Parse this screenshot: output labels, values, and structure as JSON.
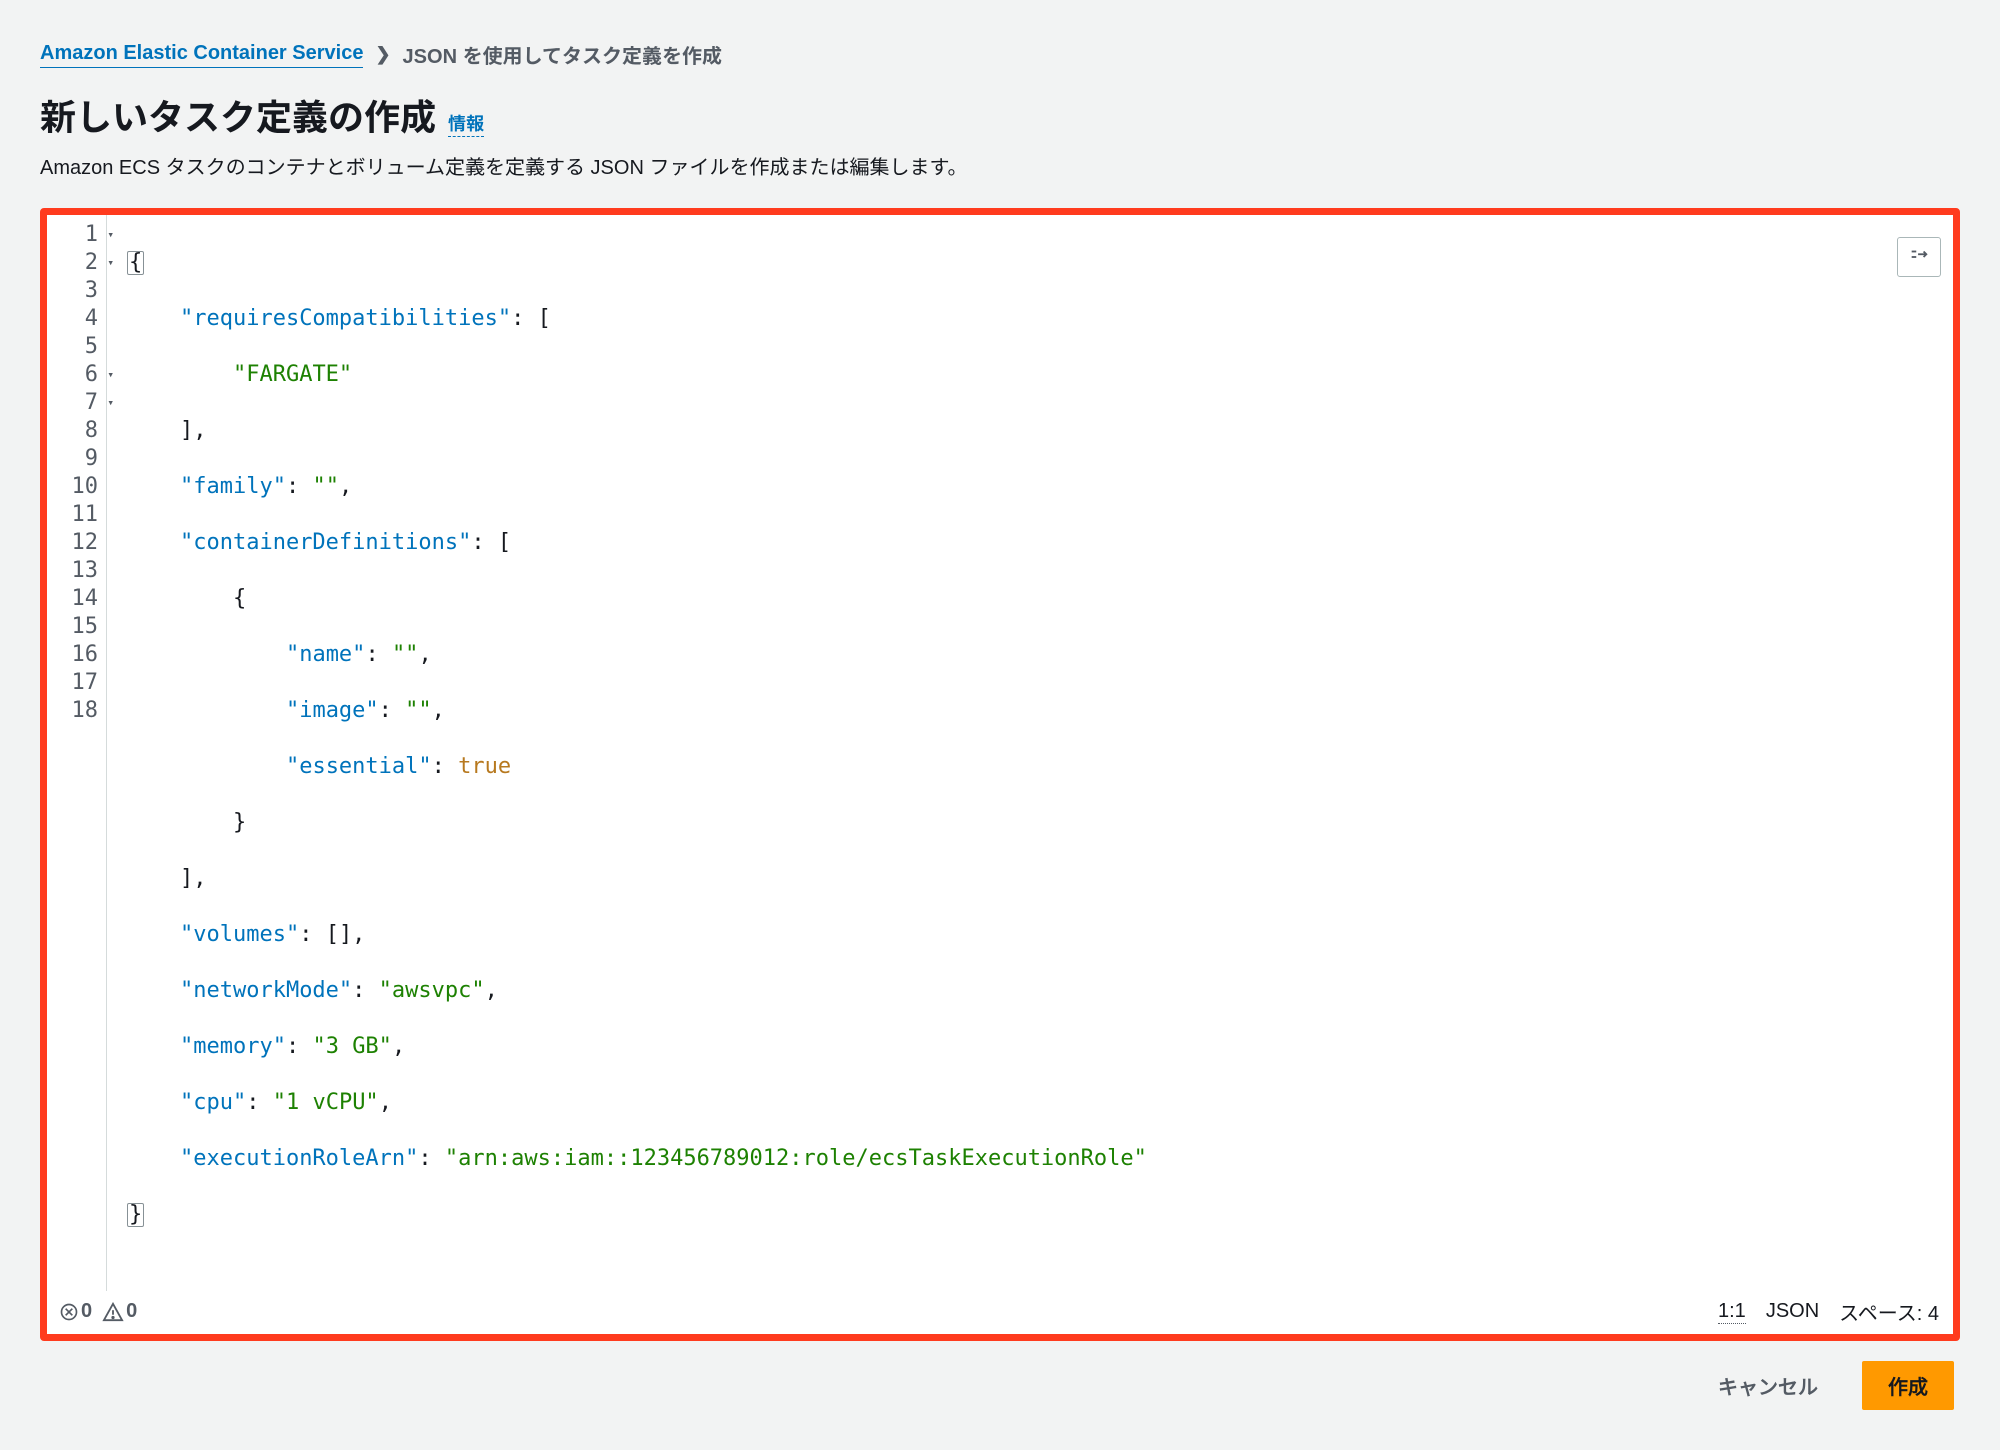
{
  "breadcrumb": {
    "root": "Amazon Elastic Container Service",
    "current": "JSON を使用してタスク定義を作成"
  },
  "header": {
    "title": "新しいタスク定義の作成",
    "info": "情報",
    "subtitle": "Amazon ECS タスクのコンテナとボリューム定義を定義する JSON ファイルを作成または編集します。"
  },
  "editor": {
    "line_numbers": [
      "1",
      "2",
      "3",
      "4",
      "5",
      "6",
      "7",
      "8",
      "9",
      "10",
      "11",
      "12",
      "13",
      "14",
      "15",
      "16",
      "17",
      "18"
    ],
    "fold_lines": [
      1,
      2,
      6,
      7
    ],
    "code": {
      "l1": "{",
      "l2_key": "\"requiresCompatibilities\"",
      "l2_rest": ": [",
      "l3_val": "\"FARGATE\"",
      "l4": "],",
      "l5_key": "\"family\"",
      "l5_rest": ": ",
      "l5_val": "\"\"",
      "l5_end": ",",
      "l6_key": "\"containerDefinitions\"",
      "l6_rest": ": [",
      "l7": "{",
      "l8_key": "\"name\"",
      "l8_rest": ": ",
      "l8_val": "\"\"",
      "l8_end": ",",
      "l9_key": "\"image\"",
      "l9_rest": ": ",
      "l9_val": "\"\"",
      "l9_end": ",",
      "l10_key": "\"essential\"",
      "l10_rest": ": ",
      "l10_val": "true",
      "l11": "}",
      "l12": "],",
      "l13_key": "\"volumes\"",
      "l13_rest": ": [],",
      "l14_key": "\"networkMode\"",
      "l14_rest": ": ",
      "l14_val": "\"awsvpc\"",
      "l14_end": ",",
      "l15_key": "\"memory\"",
      "l15_rest": ": ",
      "l15_val": "\"3 GB\"",
      "l15_end": ",",
      "l16_key": "\"cpu\"",
      "l16_rest": ": ",
      "l16_val": "\"1 vCPU\"",
      "l16_end": ",",
      "l17_key": "\"executionRoleArn\"",
      "l17_rest": ": ",
      "l17_val": "\"arn:aws:iam::123456789012:role/ecsTaskExecutionRole\"",
      "l18": "}"
    },
    "status": {
      "errors": "0",
      "warnings": "0",
      "cursor": "1:1",
      "language": "JSON",
      "spaces": "スペース: 4"
    }
  },
  "actions": {
    "cancel": "キャンセル",
    "create": "作成"
  }
}
